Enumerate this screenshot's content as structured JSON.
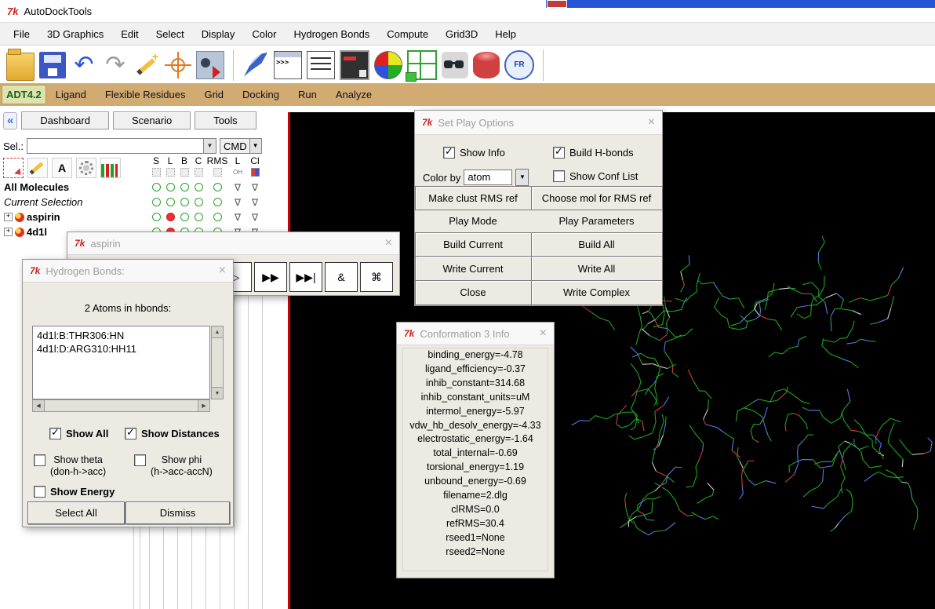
{
  "window": {
    "title": "AutoDockTools",
    "tk_badge": "7k"
  },
  "menu_bar": {
    "items": [
      "File",
      "3D Graphics",
      "Edit",
      "Select",
      "Display",
      "Color",
      "Hydrogen Bonds",
      "Compute",
      "Grid3D",
      "Help"
    ]
  },
  "toolbar": {
    "icons": [
      "open-file-icon",
      "save-icon",
      "undo-icon",
      "redo-icon",
      "pencil-spark-icon",
      "center-target-icon",
      "camera-export-icon",
      "divider",
      "pen-icon",
      "python-shell-icon",
      "text-lines-icon",
      "monitor-icon",
      "color-sphere-icon",
      "grid-box-icon",
      "3d-glasses-icon",
      "spin-barrel-icon",
      "fr-badge-icon",
      "divider"
    ],
    "shell_glyph": ">>>",
    "fr_label": "FR"
  },
  "mode_bar": {
    "adt_version": "ADT4.2",
    "tabs": [
      "Ligand",
      "Flexible Residues",
      "Grid",
      "Docking",
      "Run",
      "Analyze"
    ]
  },
  "sidebar": {
    "collapse_chevron": "«",
    "tabs": [
      "Dashboard",
      "Scenario",
      "Tools"
    ],
    "sel_label": "Sel.:",
    "cmd_label": "CMD",
    "icon_row": [
      "select-grid-icon",
      "pencil-icon",
      "label-a-icon",
      "gear-icon",
      "histogram-icon"
    ],
    "icon_a_label": "A",
    "columns": [
      "S",
      "L",
      "B",
      "C",
      "RMS",
      "L",
      "Cl"
    ],
    "column_glyphs": [
      "",
      "",
      "",
      "",
      "",
      "OH",
      ""
    ],
    "tree_rows": [
      {
        "label": "All Molecules",
        "style": "bold",
        "expander": false,
        "cells": [
          "o",
          "o",
          "o",
          "o",
          "o",
          "t",
          "t"
        ]
      },
      {
        "label": "Current Selection",
        "style": "italic",
        "expander": false,
        "cells": [
          "o",
          "o",
          "o",
          "o",
          "o",
          "t",
          "t"
        ]
      },
      {
        "label": "aspirin",
        "style": "bold",
        "expander": true,
        "cells": [
          "o",
          "r",
          "o",
          "o",
          "o",
          "t",
          "t"
        ]
      },
      {
        "label": "4d1l",
        "style": "bold",
        "expander": true,
        "cells": [
          "o",
          "r",
          "o",
          "o",
          "o",
          "t",
          "t"
        ]
      }
    ]
  },
  "dialogs": {
    "play_options": {
      "title": "Set Play Options",
      "close": "×",
      "show_info": {
        "label": "Show Info",
        "checked": true
      },
      "build_hbonds": {
        "label": "Build H-bonds",
        "checked": true
      },
      "color_by_label": "Color by",
      "color_by_value": "atom",
      "show_conf_list": {
        "label": "Show Conf List",
        "checked": false
      },
      "buttons": [
        [
          "Make clust RMS ref",
          "Choose mol for RMS ref"
        ],
        [
          "Play Mode",
          "Play Parameters"
        ],
        [
          "Build Current",
          "Build All"
        ],
        [
          "Write Current",
          "Write All"
        ],
        [
          "Close",
          "Write Complex"
        ]
      ]
    },
    "player": {
      "title": "aspirin",
      "close": "×",
      "buttons": [
        "▷",
        "▶▶",
        "▶▶|",
        "&",
        "⌘"
      ]
    },
    "hbonds": {
      "title": "Hydrogen Bonds:",
      "close": "×",
      "header": "2 Atoms in hbonds:",
      "atoms": [
        "4d1l:B:THR306:HN",
        "4d1l:D:ARG310:HH11"
      ],
      "show_all": {
        "label": "Show All",
        "checked": true
      },
      "show_distances": {
        "label": "Show Distances",
        "checked": true
      },
      "show_theta": {
        "label": "Show theta",
        "sub": "(don-h->acc)",
        "checked": false
      },
      "show_phi": {
        "label": "Show phi",
        "sub": "(h->acc-accN)",
        "checked": false
      },
      "show_energy": {
        "label": "Show Energy",
        "checked": false
      },
      "select_all_button": "Select All",
      "dismiss_button": "Dismiss"
    },
    "conformation": {
      "title": "Conformation 3 Info",
      "close": "×",
      "lines": [
        "binding_energy=-4.78",
        "ligand_efficiency=-0.37",
        "inhib_constant=314.68",
        "inhib_constant_units=uM",
        "intermol_energy=-5.97",
        "vdw_hb_desolv_energy=-4.33",
        "electrostatic_energy=-1.64",
        "total_internal=-0.69",
        "torsional_energy=1.19",
        "unbound_energy=-0.69",
        "filename=2.dlg",
        "clRMS=0.0",
        "refRMS=30.4",
        "rseed1=None",
        "rseed2=None"
      ]
    }
  },
  "colors": {
    "accent_red": "#cc0000",
    "mode_bar_tan": "#d2ab72",
    "adt_green": "#1d5e1d",
    "viewport_bg": "#000000",
    "molecule_green": "#1fa51f",
    "molecule_blue": "#5a79e8",
    "molecule_red": "#d23b3b"
  }
}
